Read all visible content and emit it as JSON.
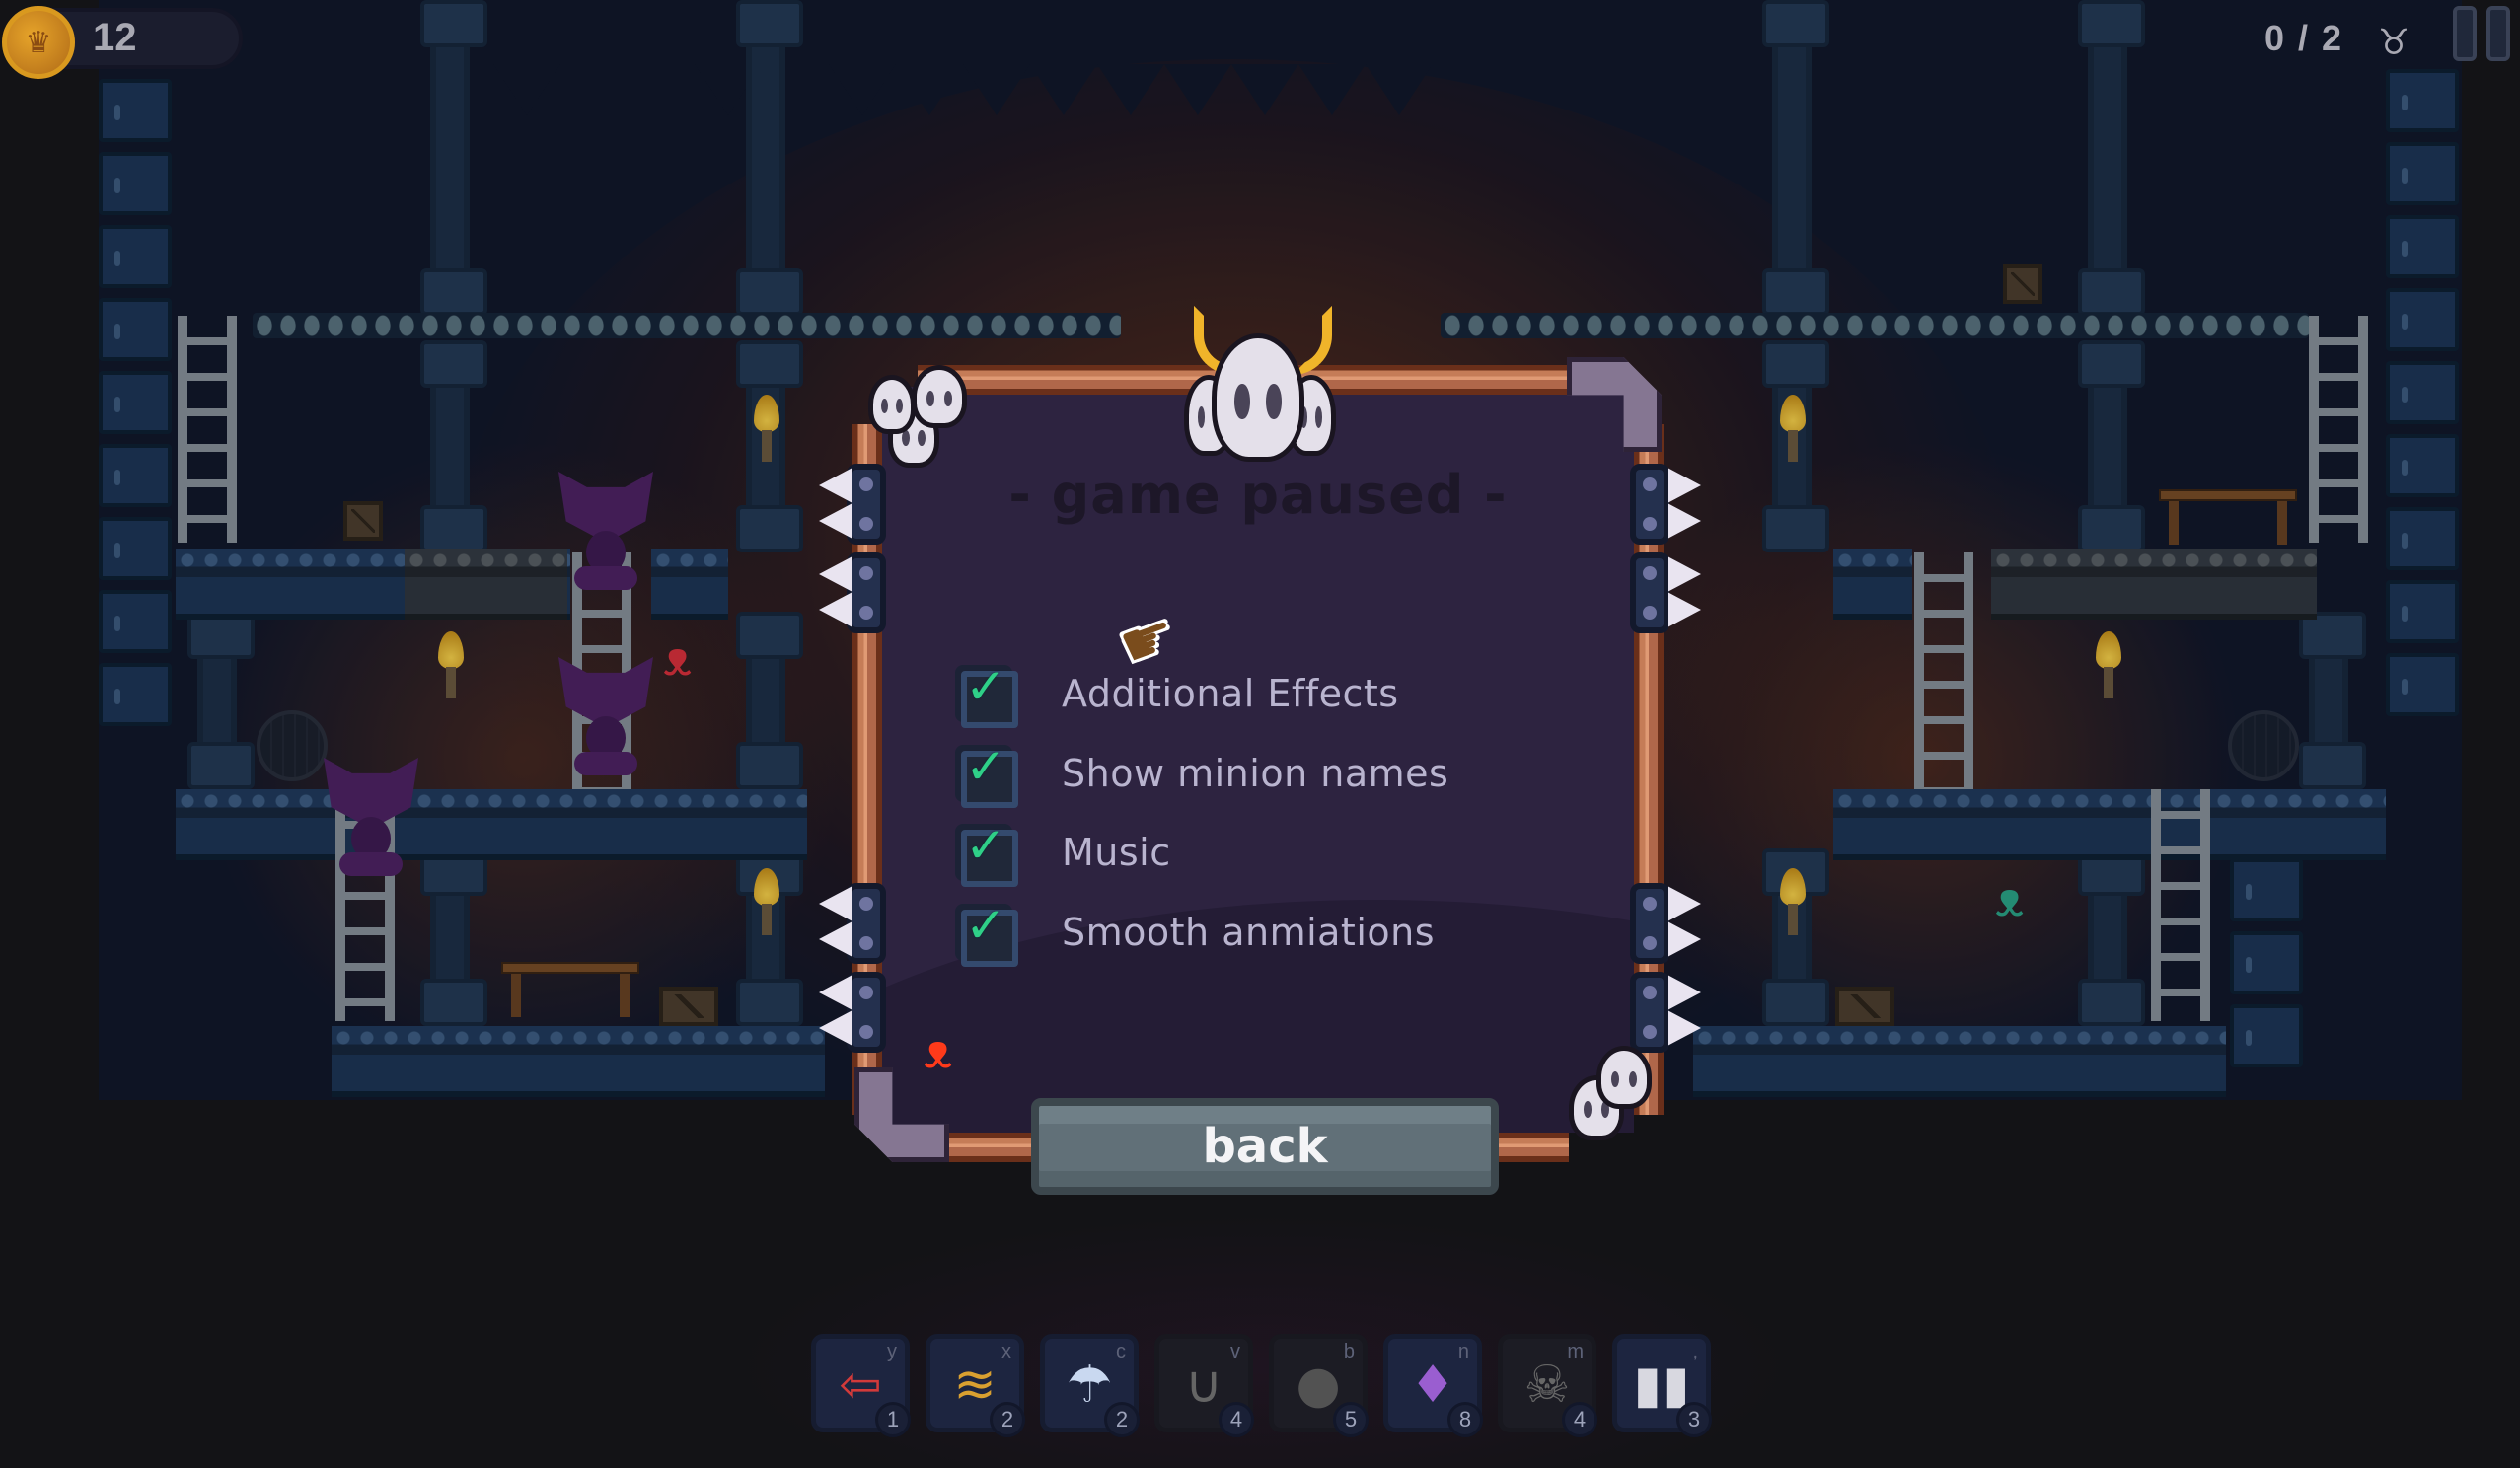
{
  "hud": {
    "coins": "12",
    "coin_icon": "crown-coin-icon",
    "goal_progress": "0 / 2",
    "goal_icon": "cattle-skull-icon",
    "pause_icon": "pause-icon"
  },
  "dialog": {
    "title": "- game paused -",
    "options": [
      {
        "label": "Additional Effects",
        "checked": true
      },
      {
        "label": "Show minion names",
        "checked": true
      },
      {
        "label": "Music",
        "checked": true
      },
      {
        "label": "Smooth anmiations",
        "checked": true
      }
    ],
    "check_glyph": "✓",
    "back_label": "back"
  },
  "cursor": {
    "icon": "glove-pointer-icon",
    "glyph": "☛"
  },
  "toolbar": {
    "items": [
      {
        "name": "arrow-sign",
        "glyph": "⇦",
        "key": "y",
        "count": "1",
        "enabled": true,
        "color": "#d23a3a"
      },
      {
        "name": "spring",
        "glyph": "≋",
        "key": "x",
        "count": "2",
        "enabled": true,
        "color": "#d9a030"
      },
      {
        "name": "umbrella",
        "glyph": "☂",
        "key": "c",
        "count": "2",
        "enabled": true,
        "color": "#c9d8f0"
      },
      {
        "name": "magnet",
        "glyph": "∪",
        "key": "v",
        "count": "4",
        "enabled": false,
        "color": "#a8a8a8"
      },
      {
        "name": "bomb",
        "glyph": "●",
        "key": "b",
        "count": "5",
        "enabled": false,
        "color": "#888888"
      },
      {
        "name": "onion",
        "glyph": "♦",
        "key": "n",
        "count": "8",
        "enabled": true,
        "color": "#9a5ed0"
      },
      {
        "name": "skull-cloak",
        "glyph": "☠",
        "key": "m",
        "count": "4",
        "enabled": false,
        "color": "#b0a8b8"
      },
      {
        "name": "rocket-boots",
        "glyph": "▮▮",
        "key": ",",
        "count": "3",
        "enabled": true,
        "color": "#d8d8e0"
      }
    ]
  },
  "level": {
    "scribbles": [
      {
        "name": "red-minion-scribble",
        "glyph": "ᴥ",
        "color": "#e0303a"
      },
      {
        "name": "teal-minion-scribble",
        "glyph": "ᴥ",
        "color": "#2aa888"
      },
      {
        "name": "red-minion-scribble-dialog",
        "glyph": "ᴥ",
        "color": "#ff3a1a"
      }
    ]
  }
}
